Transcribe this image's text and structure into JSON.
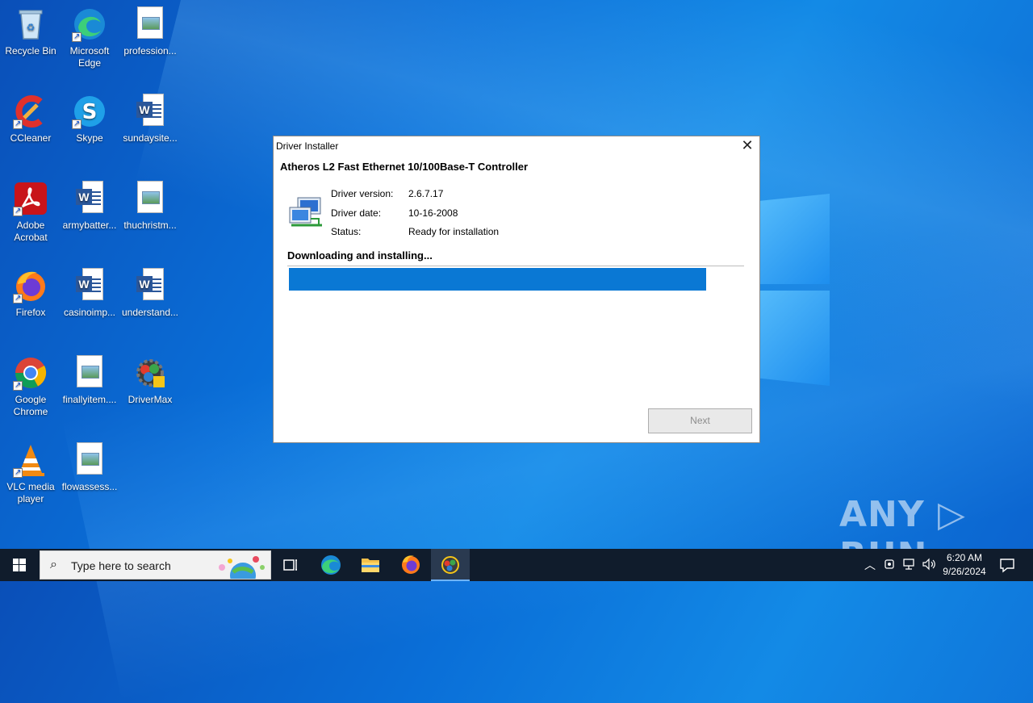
{
  "desktop": {
    "icons": [
      {
        "label": "Recycle Bin"
      },
      {
        "label": "Microsoft Edge"
      },
      {
        "label": "profession..."
      },
      {
        "label": "CCleaner"
      },
      {
        "label": "Skype"
      },
      {
        "label": "sundaysite..."
      },
      {
        "label": "Adobe Acrobat"
      },
      {
        "label": "armybatter..."
      },
      {
        "label": "thuchristm..."
      },
      {
        "label": "Firefox"
      },
      {
        "label": "casinoimp..."
      },
      {
        "label": "understand..."
      },
      {
        "label": "Google Chrome"
      },
      {
        "label": "finallyitem...."
      },
      {
        "label": "DriverMax"
      },
      {
        "label": "VLC media player"
      },
      {
        "label": "flowassess..."
      }
    ]
  },
  "dialog": {
    "title": "Driver Installer",
    "close_glyph": "✕",
    "heading": "Atheros L2 Fast Ethernet 10/100Base-T Controller",
    "version_label": "Driver version:",
    "version_value": "2.6.7.17",
    "date_label": "Driver date:",
    "date_value": "10-16-2008",
    "status_label": "Status:",
    "status_value": "Ready for installation",
    "progress_label": "Downloading and installing...",
    "progress_fraction": 0.92,
    "next_label": "Next",
    "progress_color": "#0a78d4"
  },
  "watermark": {
    "text": "ANY ▷ RUN"
  },
  "taskbar": {
    "search_placeholder": "Type here to search",
    "clock_time": "6:20 AM",
    "clock_date": "9/26/2024",
    "pinned": [
      "task-view",
      "edge",
      "file-explorer",
      "firefox",
      "drivermax"
    ]
  }
}
